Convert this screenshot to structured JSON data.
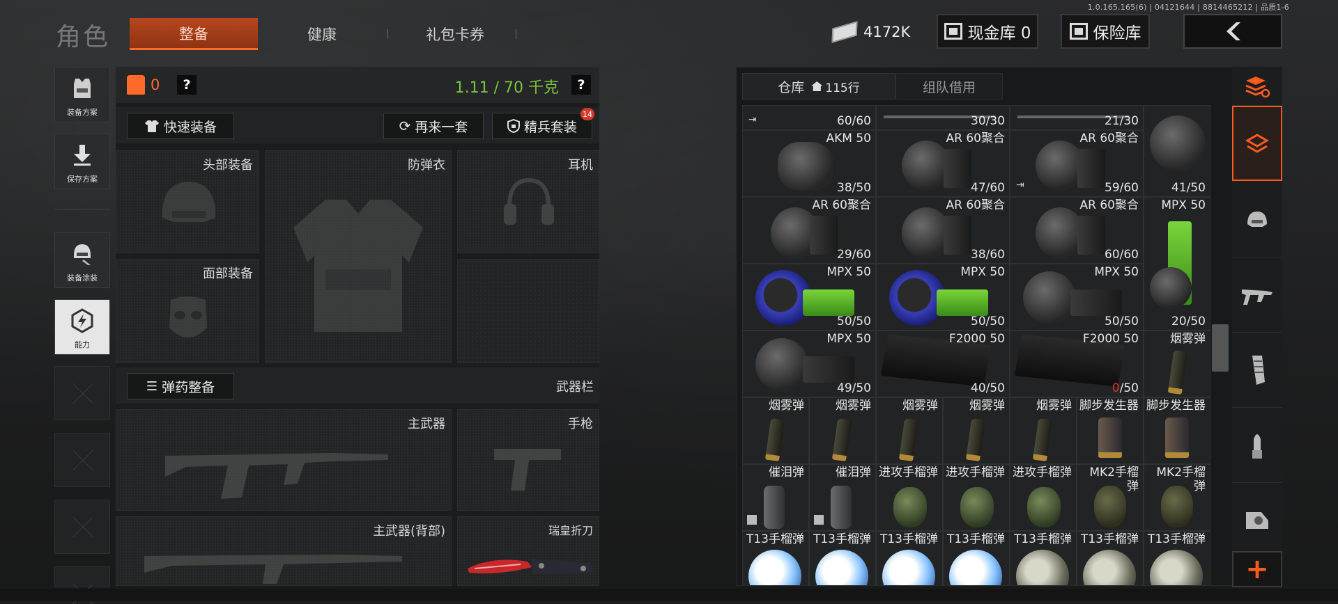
{
  "version": "1.0.165.165(6) | 04121644 | 8814465212 | 品质1-6",
  "header": {
    "title": "角色",
    "tabs": [
      {
        "label": "整备",
        "active": true
      },
      {
        "label": "健康",
        "active": false
      },
      {
        "label": "礼包卡券",
        "active": false
      }
    ],
    "money": "4172K",
    "cash_vault": "现金库 0",
    "insurance_vault": "保险库",
    "back_icon": "chevron-left-icon"
  },
  "sidebar": [
    {
      "label": "装备方案",
      "icon": "vest-icon"
    },
    {
      "label": "保存方案",
      "icon": "download-icon"
    },
    {
      "label": "装备涂装",
      "icon": "helmet-paint-icon"
    },
    {
      "label": "能力",
      "icon": "ability-icon",
      "active": true
    }
  ],
  "equipment": {
    "count": "0",
    "weight": "1.11 / 70 千克",
    "quick_equip": "快速装备",
    "again": "再来一套",
    "elite_set": "精兵套装",
    "elite_badge": "14",
    "slots": {
      "head": "头部装备",
      "armor": "防弹衣",
      "headset": "耳机",
      "face": "面部装备"
    },
    "ammo_equip": "弹药整备",
    "weapon_bar": "武器栏",
    "weapon_slots": {
      "primary": "主武器",
      "pistol": "手枪",
      "primary_back": "主武器(背部)",
      "knife": "瑞皇折刀"
    }
  },
  "warehouse": {
    "tab_storage": "仓库",
    "rows": "115行",
    "tab_team": "组队借用",
    "items": [
      {
        "name": "",
        "qty": "60/60"
      },
      {
        "name": "",
        "qty": "30/30"
      },
      {
        "name": "",
        "qty": "21/30"
      },
      {
        "name": "",
        "qty": ""
      },
      {
        "name": "AKM 50",
        "qty": "38/50"
      },
      {
        "name": "AR 60聚合",
        "qty": "47/60"
      },
      {
        "name": "AR 60聚合",
        "qty": "59/60"
      },
      {
        "name": "",
        "qty": "41/50"
      },
      {
        "name": "AR 60聚合",
        "qty": "29/60"
      },
      {
        "name": "AR 60聚合",
        "qty": "38/60"
      },
      {
        "name": "AR 60聚合",
        "qty": "60/60"
      },
      {
        "name": "MPX 50",
        "qty": "20/50"
      },
      {
        "name": "MPX 50",
        "qty": "50/50"
      },
      {
        "name": "MPX 50",
        "qty": "50/50"
      },
      {
        "name": "MPX 50",
        "qty": "50/50"
      },
      {
        "name": "MPX 50",
        "qty": "49/50"
      },
      {
        "name": "F2000 50",
        "qty": "40/50"
      },
      {
        "name": "F2000 50",
        "qty": "0/50"
      },
      {
        "name": "烟雾弹",
        "qty": ""
      },
      {
        "name": "烟雾弹"
      },
      {
        "name": "烟雾弹"
      },
      {
        "name": "烟雾弹"
      },
      {
        "name": "烟雾弹"
      },
      {
        "name": "烟雾弹"
      },
      {
        "name": "脚步发生器"
      },
      {
        "name": "脚步发生器"
      },
      {
        "name": "催泪弹"
      },
      {
        "name": "催泪弹"
      },
      {
        "name": "进攻手榴弹"
      },
      {
        "name": "进攻手榴弹"
      },
      {
        "name": "进攻手榴弹"
      },
      {
        "name": "MK2手榴弹"
      },
      {
        "name": "MK2手榴弹"
      },
      {
        "name": "T13手榴弹"
      },
      {
        "name": "T13手榴弹"
      },
      {
        "name": "T13手榴弹"
      },
      {
        "name": "T13手榴弹"
      },
      {
        "name": "T13手榴弹"
      },
      {
        "name": "T13手榴弹"
      },
      {
        "name": "T13手榴弹"
      }
    ]
  },
  "categories": [
    {
      "icon": "sort-stack-icon",
      "active": false
    },
    {
      "icon": "all-items-icon",
      "active": true
    },
    {
      "icon": "helmet-icon",
      "active": false
    },
    {
      "icon": "rifle-icon",
      "active": false
    },
    {
      "icon": "magazine-icon",
      "active": false
    },
    {
      "icon": "bullet-icon",
      "active": false
    },
    {
      "icon": "attachment-icon",
      "active": false
    }
  ],
  "add_button": "+"
}
